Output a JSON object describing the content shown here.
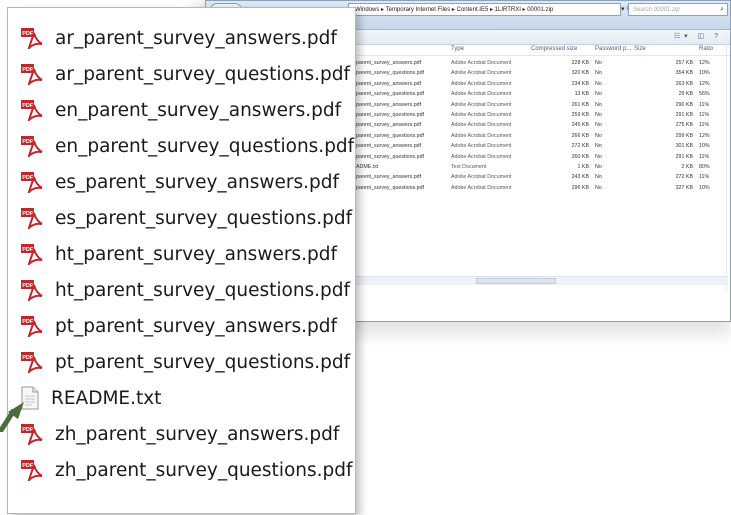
{
  "explorer": {
    "address_path": "Windows ▸ Temporary Internet Files ▸ Content.IE5 ▸ 1LIRTRXI ▸ 00001.zip",
    "search_placeholder": "Search 00001.zip",
    "columns": [
      "Type",
      "Compressed size",
      "Password p...",
      "Size",
      "Ratio"
    ],
    "rows": [
      {
        "name": "parent_survey_answers.pdf",
        "type": "Adobe Acrobat Document",
        "compressed": "228 KB",
        "password": "No",
        "size": "257 KB",
        "ratio": "12%"
      },
      {
        "name": "parent_survey_questions.pdf",
        "type": "Adobe Acrobat Document",
        "compressed": "320 KB",
        "password": "No",
        "size": "354 KB",
        "ratio": "10%"
      },
      {
        "name": "parent_survey_answers.pdf",
        "type": "Adobe Acrobat Document",
        "compressed": "234 KB",
        "password": "No",
        "size": "263 KB",
        "ratio": "12%"
      },
      {
        "name": "parent_survey_questions.pdf",
        "type": "Adobe Acrobat Document",
        "compressed": "13 KB",
        "password": "No",
        "size": "29 KB",
        "ratio": "56%"
      },
      {
        "name": "parent_survey_answers.pdf",
        "type": "Adobe Acrobat Document",
        "compressed": "261 KB",
        "password": "No",
        "size": "290 KB",
        "ratio": "11%"
      },
      {
        "name": "parent_survey_questions.pdf",
        "type": "Adobe Acrobat Document",
        "compressed": "259 KB",
        "password": "No",
        "size": "291 KB",
        "ratio": "11%"
      },
      {
        "name": "parent_survey_answers.pdf",
        "type": "Adobe Acrobat Document",
        "compressed": "245 KB",
        "password": "No",
        "size": "275 KB",
        "ratio": "11%"
      },
      {
        "name": "parent_survey_questions.pdf",
        "type": "Adobe Acrobat Document",
        "compressed": "266 KB",
        "password": "No",
        "size": "299 KB",
        "ratio": "12%"
      },
      {
        "name": "parent_survey_answers.pdf",
        "type": "Adobe Acrobat Document",
        "compressed": "272 KB",
        "password": "No",
        "size": "301 KB",
        "ratio": "10%"
      },
      {
        "name": "parent_survey_questions.pdf",
        "type": "Adobe Acrobat Document",
        "compressed": "260 KB",
        "password": "No",
        "size": "291 KB",
        "ratio": "11%"
      },
      {
        "name": "ADME.txt",
        "type": "Text Document",
        "compressed": "1 KB",
        "password": "No",
        "size": "2 KB",
        "ratio": "80%"
      },
      {
        "name": "parent_survey_answers.pdf",
        "type": "Adobe Acrobat Document",
        "compressed": "243 KB",
        "password": "No",
        "size": "272 KB",
        "ratio": "11%"
      },
      {
        "name": "parent_survey_questions.pdf",
        "type": "Adobe Acrobat Document",
        "compressed": "296 KB",
        "password": "No",
        "size": "327 KB",
        "ratio": "10%"
      }
    ]
  },
  "files": [
    {
      "label": "ar_parent_survey_answers.pdf",
      "icon": "pdf-icon"
    },
    {
      "label": "ar_parent_survey_questions.pdf",
      "icon": "pdf-icon"
    },
    {
      "label": "en_parent_survey_answers.pdf",
      "icon": "pdf-icon"
    },
    {
      "label": "en_parent_survey_questions.pdf",
      "icon": "pdf-icon"
    },
    {
      "label": "es_parent_survey_answers.pdf",
      "icon": "pdf-icon"
    },
    {
      "label": "es_parent_survey_questions.pdf",
      "icon": "pdf-icon"
    },
    {
      "label": "ht_parent_survey_answers.pdf",
      "icon": "pdf-icon"
    },
    {
      "label": "ht_parent_survey_questions.pdf",
      "icon": "pdf-icon"
    },
    {
      "label": "pt_parent_survey_answers.pdf",
      "icon": "pdf-icon"
    },
    {
      "label": "pt_parent_survey_questions.pdf",
      "icon": "pdf-icon"
    },
    {
      "label": "README.txt",
      "icon": "txt-icon"
    },
    {
      "label": "zh_parent_survey_answers.pdf",
      "icon": "pdf-icon"
    },
    {
      "label": "zh_parent_survey_questions.pdf",
      "icon": "pdf-icon"
    }
  ],
  "colors": {
    "pdf_red": "#c0282c",
    "arrow_green": "#4a6b3a",
    "window_border": "#8aa0bb"
  }
}
